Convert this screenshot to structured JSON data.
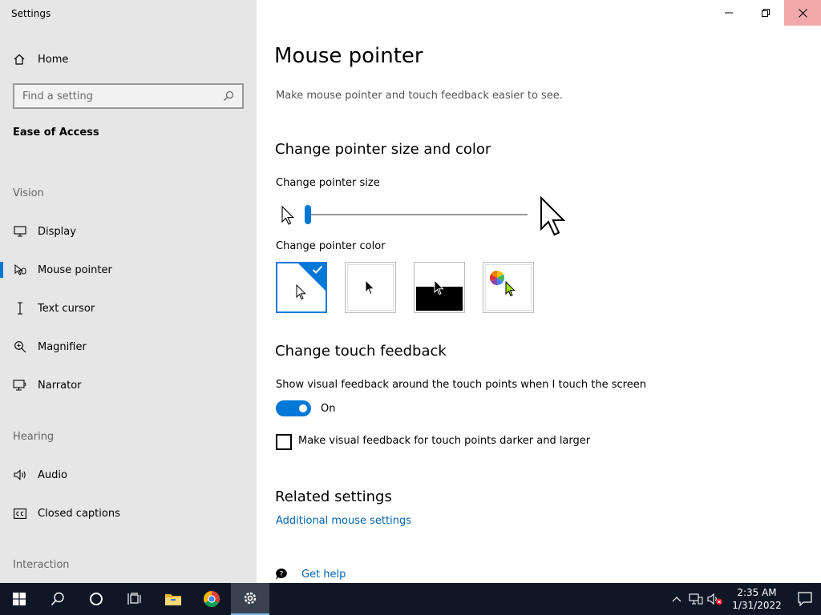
{
  "window": {
    "title": "Settings"
  },
  "sidebar": {
    "home_label": "Home",
    "search_placeholder": "Find a setting",
    "section_title": "Ease of Access",
    "groups": {
      "vision": "Vision",
      "hearing": "Hearing",
      "interaction": "Interaction"
    },
    "items": [
      {
        "label": "Display",
        "icon": "display-icon"
      },
      {
        "label": "Mouse pointer",
        "icon": "mouse-pointer-icon",
        "active": true
      },
      {
        "label": "Text cursor",
        "icon": "text-cursor-icon"
      },
      {
        "label": "Magnifier",
        "icon": "magnifier-icon"
      },
      {
        "label": "Narrator",
        "icon": "narrator-icon"
      },
      {
        "label": "Audio",
        "icon": "audio-icon"
      },
      {
        "label": "Closed captions",
        "icon": "closed-captions-icon"
      }
    ]
  },
  "main": {
    "title": "Mouse pointer",
    "description": "Make mouse pointer and touch feedback easier to see.",
    "pointer_section": {
      "heading": "Change pointer size and color",
      "size_label": "Change pointer size",
      "size_level": 1,
      "size_min": 1,
      "size_max": 15,
      "color_label": "Change pointer color",
      "color_options": [
        {
          "name": "white",
          "selected": true
        },
        {
          "name": "black"
        },
        {
          "name": "inverted"
        },
        {
          "name": "custom",
          "accent": "#a4e01a"
        }
      ]
    },
    "touch_section": {
      "heading": "Change touch feedback",
      "toggle_label": "Show visual feedback around the touch points when I touch the screen",
      "toggle_state": "On",
      "checkbox_label": "Make visual feedback for touch points darker and larger",
      "checkbox_checked": false
    },
    "related": {
      "heading": "Related settings",
      "link": "Additional mouse settings"
    },
    "help_link": "Get help"
  },
  "taskbar": {
    "time": "2:35 AM",
    "date": "1/31/2022"
  },
  "colors": {
    "accent": "#0078d7",
    "sidebar_bg": "#e6e6e6",
    "taskbar_bg": "#0f1726",
    "link": "#0063b1"
  }
}
